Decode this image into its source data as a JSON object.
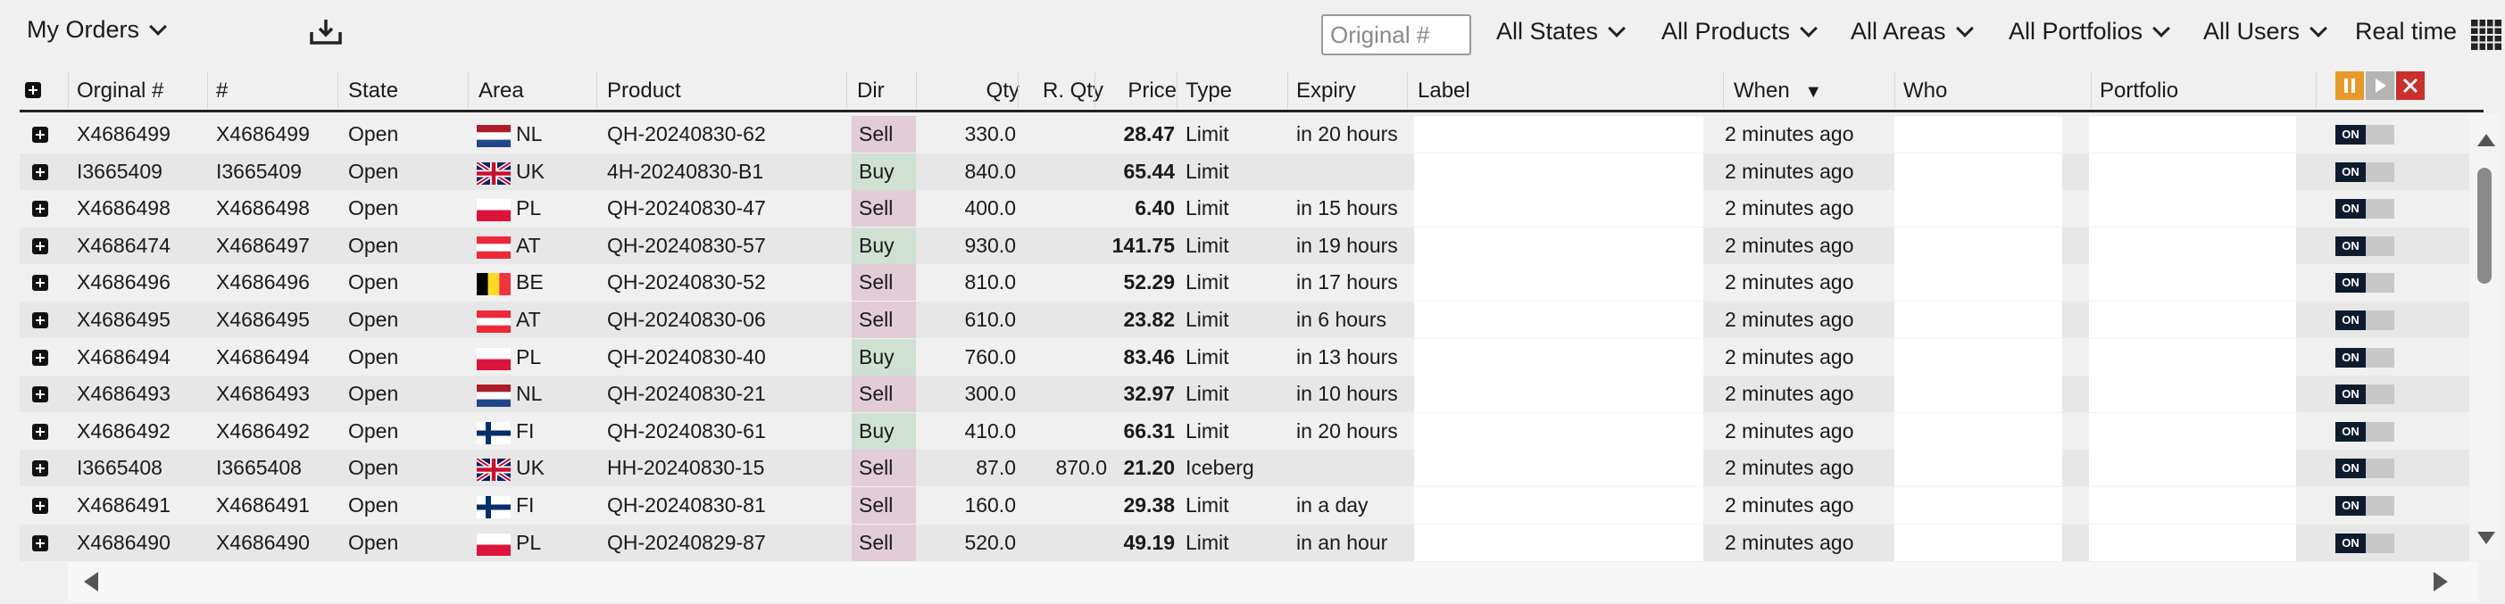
{
  "toolbar": {
    "title": "My Orders",
    "search_placeholder": "Original #",
    "filters": [
      "All States",
      "All Products",
      "All Areas",
      "All Portfolios",
      "All Users"
    ],
    "realtime_label": "Real time"
  },
  "table": {
    "headers": {
      "original": "Orginal #",
      "num": "#",
      "state": "State",
      "area": "Area",
      "product": "Product",
      "dir": "Dir",
      "qty": "Qty",
      "rqty": "R. Qty",
      "price": "Price",
      "type": "Type",
      "expiry": "Expiry",
      "label": "Label",
      "when": "When",
      "when_sort": "▼",
      "who": "Who",
      "portfolio": "Portfolio"
    },
    "toggle_label": "ON",
    "rows": [
      {
        "original": "X4686499",
        "num": "X4686499",
        "state": "Open",
        "flag": "NL",
        "area": "NL",
        "product": "QH-20240830-62",
        "dir": "Sell",
        "qty": "330.0",
        "rqty": "",
        "price": "28.47",
        "type": "Limit",
        "expiry": "in 20 hours",
        "when": "2 minutes ago"
      },
      {
        "original": "I3665409",
        "num": "I3665409",
        "state": "Open",
        "flag": "UK",
        "area": "UK",
        "product": "4H-20240830-B1",
        "dir": "Buy",
        "qty": "840.0",
        "rqty": "",
        "price": "65.44",
        "type": "Limit",
        "expiry": "",
        "when": "2 minutes ago"
      },
      {
        "original": "X4686498",
        "num": "X4686498",
        "state": "Open",
        "flag": "PL",
        "area": "PL",
        "product": "QH-20240830-47",
        "dir": "Sell",
        "qty": "400.0",
        "rqty": "",
        "price": "6.40",
        "type": "Limit",
        "expiry": "in 15 hours",
        "when": "2 minutes ago"
      },
      {
        "original": "X4686474",
        "num": "X4686497",
        "state": "Open",
        "flag": "AT",
        "area": "AT",
        "product": "QH-20240830-57",
        "dir": "Buy",
        "qty": "930.0",
        "rqty": "",
        "price": "141.75",
        "type": "Limit",
        "expiry": "in 19 hours",
        "when": "2 minutes ago"
      },
      {
        "original": "X4686496",
        "num": "X4686496",
        "state": "Open",
        "flag": "BE",
        "area": "BE",
        "product": "QH-20240830-52",
        "dir": "Sell",
        "qty": "810.0",
        "rqty": "",
        "price": "52.29",
        "type": "Limit",
        "expiry": "in 17 hours",
        "when": "2 minutes ago"
      },
      {
        "original": "X4686495",
        "num": "X4686495",
        "state": "Open",
        "flag": "AT",
        "area": "AT",
        "product": "QH-20240830-06",
        "dir": "Sell",
        "qty": "610.0",
        "rqty": "",
        "price": "23.82",
        "type": "Limit",
        "expiry": "in 6 hours",
        "when": "2 minutes ago"
      },
      {
        "original": "X4686494",
        "num": "X4686494",
        "state": "Open",
        "flag": "PL",
        "area": "PL",
        "product": "QH-20240830-40",
        "dir": "Buy",
        "qty": "760.0",
        "rqty": "",
        "price": "83.46",
        "type": "Limit",
        "expiry": "in 13 hours",
        "when": "2 minutes ago"
      },
      {
        "original": "X4686493",
        "num": "X4686493",
        "state": "Open",
        "flag": "NL",
        "area": "NL",
        "product": "QH-20240830-21",
        "dir": "Sell",
        "qty": "300.0",
        "rqty": "",
        "price": "32.97",
        "type": "Limit",
        "expiry": "in 10 hours",
        "when": "2 minutes ago"
      },
      {
        "original": "X4686492",
        "num": "X4686492",
        "state": "Open",
        "flag": "FI",
        "area": "FI",
        "product": "QH-20240830-61",
        "dir": "Buy",
        "qty": "410.0",
        "rqty": "",
        "price": "66.31",
        "type": "Limit",
        "expiry": "in 20 hours",
        "when": "2 minutes ago"
      },
      {
        "original": "I3665408",
        "num": "I3665408",
        "state": "Open",
        "flag": "UK",
        "area": "UK",
        "product": "HH-20240830-15",
        "dir": "Sell",
        "qty": "87.0",
        "rqty": "870.0",
        "price": "21.20",
        "type": "Iceberg",
        "expiry": "",
        "when": "2 minutes ago"
      },
      {
        "original": "X4686491",
        "num": "X4686491",
        "state": "Open",
        "flag": "FI",
        "area": "FI",
        "product": "QH-20240830-81",
        "dir": "Sell",
        "qty": "160.0",
        "rqty": "",
        "price": "29.38",
        "type": "Limit",
        "expiry": "in a day",
        "when": "2 minutes ago"
      },
      {
        "original": "X4686490",
        "num": "X4686490",
        "state": "Open",
        "flag": "PL",
        "area": "PL",
        "product": "QH-20240829-87",
        "dir": "Sell",
        "qty": "520.0",
        "rqty": "",
        "price": "49.19",
        "type": "Limit",
        "expiry": "in an hour",
        "when": "2 minutes ago"
      }
    ]
  },
  "colors": {
    "sell_bg": "#e2ccd7",
    "buy_bg": "#cfe1d3",
    "pause_button": "#e79a2b",
    "play_button": "#b4b4b4",
    "close_button": "#c9302c"
  }
}
